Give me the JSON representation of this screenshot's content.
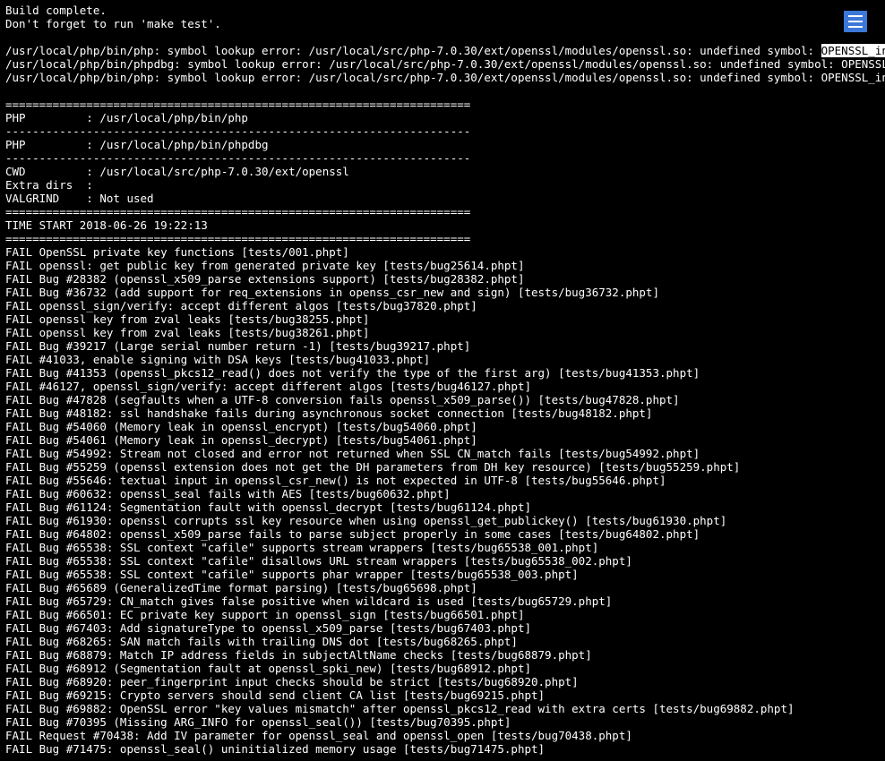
{
  "intro": [
    "Build complete.",
    "Don't forget to run 'make test'.",
    ""
  ],
  "err_prefix1": "/usr/local/php/bin/php: symbol lookup error: /usr/local/src/php-7.0.30/ext/openssl/modules/openssl.so: undefined symbol: ",
  "err_hl": "OPENSSL_init_ssl",
  "err2": "/usr/local/php/bin/phpdbg: symbol lookup error: /usr/local/src/php-7.0.30/ext/openssl/modules/openssl.so: undefined symbol: OPENSSL_init_ssl",
  "err3": "/usr/local/php/bin/php: symbol lookup error: /usr/local/src/php-7.0.30/ext/openssl/modules/openssl.so: undefined symbol: OPENSSL_init_ssl",
  "sep_eq": "=====================================================================",
  "sep_dash": "---------------------------------------------------------------------",
  "rows": [
    "PHP         : /usr/local/php/bin/php",
    "PHP         : /usr/local/php/bin/phpdbg",
    "CWD         : /usr/local/src/php-7.0.30/ext/openssl",
    "Extra dirs  :",
    "VALGRIND    : Not used"
  ],
  "time_line": "TIME START 2018-06-26 19:22:13",
  "fails": [
    "FAIL OpenSSL private key functions [tests/001.phpt]",
    "FAIL openssl: get public key from generated private key [tests/bug25614.phpt]",
    "FAIL Bug #28382 (openssl_x509_parse extensions support) [tests/bug28382.phpt]",
    "FAIL Bug #36732 (add support for req_extensions in openss_csr_new and sign) [tests/bug36732.phpt]",
    "FAIL openssl_sign/verify: accept different algos [tests/bug37820.phpt]",
    "FAIL openssl key from zval leaks [tests/bug38255.phpt]",
    "FAIL openssl key from zval leaks [tests/bug38261.phpt]",
    "FAIL Bug #39217 (Large serial number return -1) [tests/bug39217.phpt]",
    "FAIL #41033, enable signing with DSA keys [tests/bug41033.phpt]",
    "FAIL Bug #41353 (openssl_pkcs12_read() does not verify the type of the first arg) [tests/bug41353.phpt]",
    "FAIL #46127, openssl_sign/verify: accept different algos [tests/bug46127.phpt]",
    "FAIL Bug #47828 (segfaults when a UTF-8 conversion fails openssl_x509_parse()) [tests/bug47828.phpt]",
    "FAIL Bug #48182: ssl handshake fails during asynchronous socket connection [tests/bug48182.phpt]",
    "FAIL Bug #54060 (Memory leak in openssl_encrypt) [tests/bug54060.phpt]",
    "FAIL Bug #54061 (Memory leak in openssl_decrypt) [tests/bug54061.phpt]",
    "FAIL Bug #54992: Stream not closed and error not returned when SSL CN_match fails [tests/bug54992.phpt]",
    "FAIL Bug #55259 (openssl extension does not get the DH parameters from DH key resource) [tests/bug55259.phpt]",
    "FAIL Bug #55646: textual input in openssl_csr_new() is not expected in UTF-8 [tests/bug55646.phpt]",
    "FAIL Bug #60632: openssl_seal fails with AES [tests/bug60632.phpt]",
    "FAIL Bug #61124: Segmentation fault with openssl_decrypt [tests/bug61124.phpt]",
    "FAIL Bug #61930: openssl corrupts ssl key resource when using openssl_get_publickey() [tests/bug61930.phpt]",
    "FAIL Bug #64802: openssl_x509_parse fails to parse subject properly in some cases [tests/bug64802.phpt]",
    "FAIL Bug #65538: SSL context \"cafile\" supports stream wrappers [tests/bug65538_001.phpt]",
    "FAIL Bug #65538: SSL context \"cafile\" disallows URL stream wrappers [tests/bug65538_002.phpt]",
    "FAIL Bug #65538: SSL context \"cafile\" supports phar wrapper [tests/bug65538_003.phpt]",
    "FAIL Bug #65689 (GeneralizedTime format parsing) [tests/bug65698.phpt]",
    "FAIL Bug #65729: CN_match gives false positive when wildcard is used [tests/bug65729.phpt]",
    "FAIL Bug #66501: EC private key support in openssl_sign [tests/bug66501.phpt]",
    "FAIL Bug #67403: Add signatureType to openssl_x509_parse [tests/bug67403.phpt]",
    "FAIL Bug #68265: SAN match fails with trailing DNS dot [tests/bug68265.phpt]",
    "FAIL Bug #68879: Match IP address fields in subjectAltName checks [tests/bug68879.phpt]",
    "FAIL Bug #68912 (Segmentation fault at openssl_spki_new) [tests/bug68912.phpt]",
    "FAIL Bug #68920: peer_fingerprint input checks should be strict [tests/bug68920.phpt]",
    "FAIL Bug #69215: Crypto servers should send client CA list [tests/bug69215.phpt]",
    "FAIL Bug #69882: OpenSSL error \"key values mismatch\" after openssl_pkcs12_read with extra certs [tests/bug69882.phpt]",
    "FAIL Bug #70395 (Missing ARG_INFO for openssl_seal()) [tests/bug70395.phpt]",
    "FAIL Request #70438: Add IV parameter for openssl_seal and openssl_open [tests/bug70438.phpt]",
    "FAIL Bug #71475: openssl_seal() uninitialized memory usage [tests/bug71475.phpt]"
  ],
  "menu_label": "menu"
}
